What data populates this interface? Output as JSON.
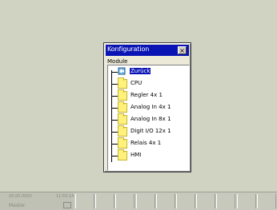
{
  "dialog": {
    "title": "Konfiguration",
    "close_label": "×",
    "modules_label": "Module",
    "tree_items": [
      {
        "label": "Zurück",
        "icon": "back-icon",
        "selected": true
      },
      {
        "label": "CPU",
        "icon": "folder-icon"
      },
      {
        "label": "Regler 4x 1",
        "icon": "folder-icon"
      },
      {
        "label": "Analog In 4x 1",
        "icon": "folder-icon"
      },
      {
        "label": "Analog In 8x 1",
        "icon": "folder-icon"
      },
      {
        "label": "Digit I/O 12x 1",
        "icon": "folder-icon"
      },
      {
        "label": "Relais 4x 1",
        "icon": "folder-icon"
      },
      {
        "label": "HMI",
        "icon": "folder-icon"
      }
    ]
  },
  "taskbar": {
    "date": "00.00.0000",
    "time": "11:50:14",
    "user": "Master",
    "slot_count": 10
  },
  "colors": {
    "titlebar": "#0a14b4",
    "desktop": "#d0d2c2",
    "folder": "#fff27a"
  }
}
